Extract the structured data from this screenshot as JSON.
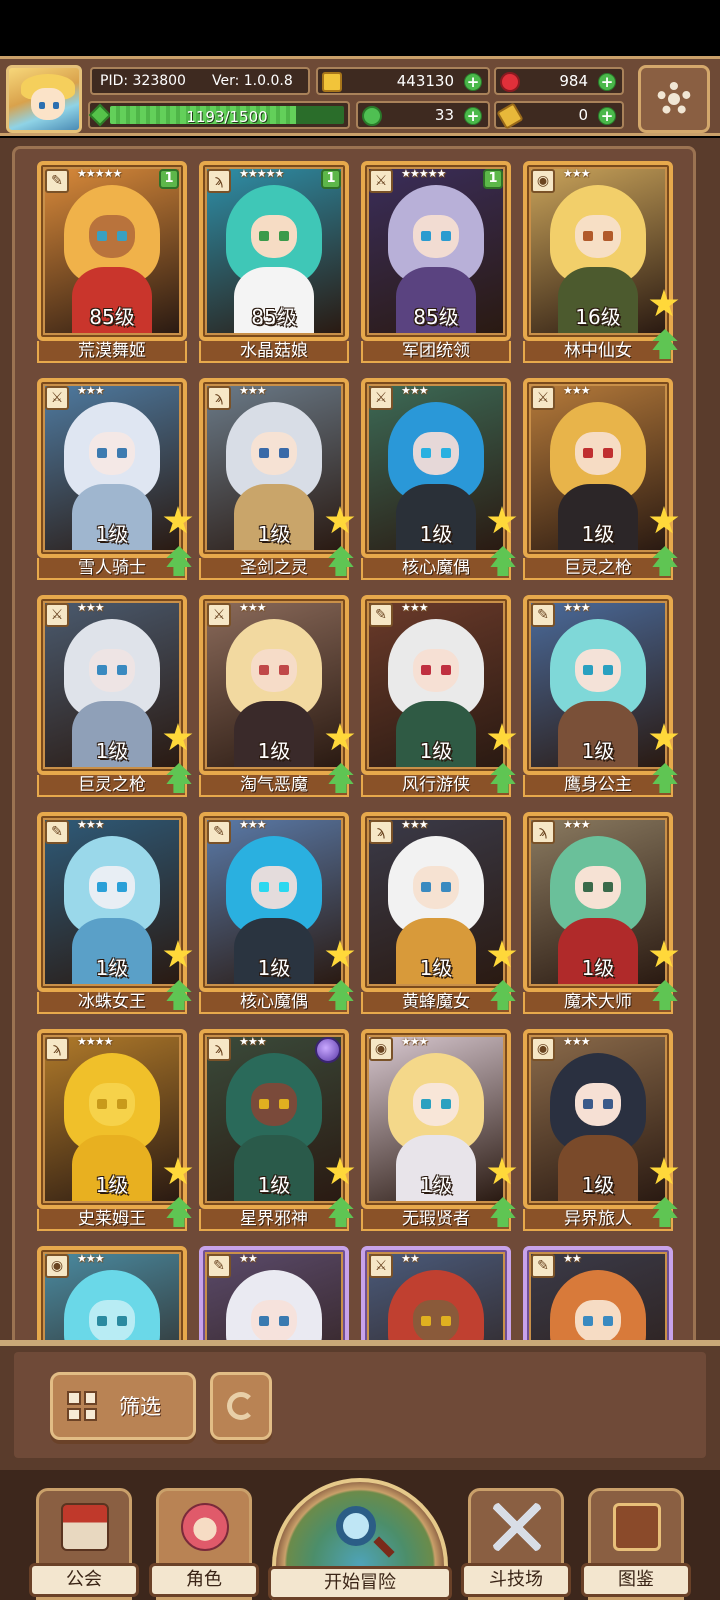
{
  "player": {
    "pid": "PID: 323800",
    "version": "Ver: 1.0.0.8",
    "xp_text": "1193/1500",
    "xp_fraction": 0.7953
  },
  "resources": {
    "gold": "443130",
    "gems": "984",
    "clover": "33",
    "keys": "0",
    "plus": "+"
  },
  "heroes": [
    {
      "name": "荒漠舞姬",
      "level": "85级",
      "stars": "★★★★★",
      "badge": "1",
      "class_icon": "feather-icon",
      "hair": "#f0b24a",
      "skin": "#b9733c",
      "body": "#c9352c",
      "bg": "#d98a3a",
      "eye": "#3aa0c0"
    },
    {
      "name": "水晶菇娘",
      "level": "85级",
      "stars": "★★★★★",
      "badge": "1",
      "class_icon": "wand-icon",
      "hair": "#3fc7b7",
      "skin": "#f6dcc4",
      "body": "#f4f4f4",
      "bg": "#2e8fa8",
      "eye": "#3a9a4a"
    },
    {
      "name": "军团统领",
      "level": "85级",
      "stars": "★★★★★",
      "badge": "1",
      "class_icon": "sword-icon",
      "hair": "#b8b0d8",
      "skin": "#f2dcd2",
      "body": "#5a4380",
      "bg": "#3a2d5a",
      "eye": "#2a9bd0"
    },
    {
      "name": "林中仙女",
      "level": "16级",
      "stars": "★★★",
      "badge": "",
      "class_icon": "shield-icon",
      "hair": "#f2cf6a",
      "skin": "#f7dfc5",
      "body": "#4c5a2e",
      "bg": "#c9a35a",
      "eye": "#b25a2a"
    },
    {
      "name": "雪人骑士",
      "level": "1级",
      "stars": "★★★",
      "badge": "",
      "class_icon": "sword-icon",
      "hair": "#dfe6f2",
      "skin": "#f4e8e6",
      "body": "#9fb6cf",
      "bg": "#4e7aa0",
      "eye": "#3d7bb0"
    },
    {
      "name": "圣剑之灵",
      "level": "1级",
      "stars": "★★★",
      "badge": "",
      "class_icon": "wand-icon",
      "hair": "#d8dde6",
      "skin": "#f6e2d4",
      "body": "#c9a56a",
      "bg": "#6a7a88",
      "eye": "#3a6aa8"
    },
    {
      "name": "核心魔偶",
      "level": "1级",
      "stars": "★★★",
      "badge": "",
      "class_icon": "sword-icon",
      "hair": "#2a98d8",
      "skin": "#e6d8d8",
      "body": "#2a3038",
      "bg": "#3c6a56",
      "eye": "#2ab0e0"
    },
    {
      "name": "巨灵之枪",
      "level": "1级",
      "stars": "★★★",
      "badge": "",
      "class_icon": "sword-icon",
      "hair": "#e8b44a",
      "skin": "#f6dcc4",
      "body": "#2c2628",
      "bg": "#b57a3a",
      "eye": "#c03030"
    },
    {
      "name": "巨灵之枪",
      "level": "1级",
      "stars": "★★★",
      "badge": "",
      "class_icon": "sword-icon",
      "hair": "#dfe3ea",
      "skin": "#eee4e4",
      "body": "#8fa0b8",
      "bg": "#4a5a6e",
      "eye": "#3a8ac0"
    },
    {
      "name": "淘气恶魔",
      "level": "1级",
      "stars": "★★★",
      "badge": "",
      "class_icon": "sword-icon",
      "hair": "#f2d9a0",
      "skin": "#f6dcc8",
      "body": "#3a2a2a",
      "bg": "#8a6a5a",
      "eye": "#c04848"
    },
    {
      "name": "风行游侠",
      "level": "1级",
      "stars": "★★★",
      "badge": "",
      "class_icon": "feather-icon",
      "hair": "#eaeaea",
      "skin": "#f6e0d4",
      "body": "#2f5a44",
      "bg": "#6a3a2a",
      "eye": "#c03040"
    },
    {
      "name": "鹰身公主",
      "level": "1级",
      "stars": "★★★",
      "badge": "",
      "class_icon": "feather-icon",
      "hair": "#7fd8d8",
      "skin": "#f4e2d8",
      "body": "#7a5038",
      "bg": "#4a6a9a",
      "eye": "#2aa0c0"
    },
    {
      "name": "冰蛛女王",
      "level": "1级",
      "stars": "★★★",
      "badge": "",
      "class_icon": "feather-icon",
      "hair": "#9ad8ea",
      "skin": "#e8eef4",
      "body": "#5aa0c8",
      "bg": "#2e5a78",
      "eye": "#2aa0d8"
    },
    {
      "name": "核心魔偶",
      "level": "1级",
      "stars": "★★★",
      "badge": "",
      "class_icon": "feather-icon",
      "hair": "#2ab0e0",
      "skin": "#e4dcdc",
      "body": "#2a3440",
      "bg": "#5a7aa8",
      "eye": "#2ad8f0"
    },
    {
      "name": "黄蜂魔女",
      "level": "1级",
      "stars": "★★★",
      "badge": "",
      "class_icon": "wand-icon",
      "hair": "#f2f2f2",
      "skin": "#f6e2d2",
      "body": "#d89a3a",
      "bg": "#3a3a48",
      "eye": "#3a8ac0"
    },
    {
      "name": "魔术大师",
      "level": "1级",
      "stars": "★★★",
      "badge": "",
      "class_icon": "wand-icon",
      "hair": "#6ac09a",
      "skin": "#f6e2d4",
      "body": "#b02a2a",
      "bg": "#8a7a60",
      "eye": "#3a6a4a"
    },
    {
      "name": "史莱姆王",
      "level": "1级",
      "stars": "★★★★",
      "badge": "",
      "class_icon": "wand-icon",
      "hair": "#f0c02a",
      "skin": "#f6d24a",
      "body": "#e8b020",
      "bg": "#b07a2a",
      "eye": "#c89a1a"
    },
    {
      "name": "星界邪神",
      "level": "1级",
      "stars": "★★★",
      "badge": "orb",
      "class_icon": "wand-icon",
      "hair": "#2a6a5a",
      "skin": "#7a4a3a",
      "body": "#2a5a4a",
      "bg": "#3a4a3a",
      "eye": "#e0b020"
    },
    {
      "name": "无瑕贤者",
      "level": "1级",
      "stars": "★★★",
      "badge": "",
      "class_icon": "shield-icon",
      "hair": "#f4d88a",
      "skin": "#f8e6d8",
      "body": "#e8e4ea",
      "bg": "#d8c8d0",
      "eye": "#2aa0c0"
    },
    {
      "name": "异界旅人",
      "level": "1级",
      "stars": "★★★",
      "badge": "",
      "class_icon": "shield-icon",
      "hair": "#2a3040",
      "skin": "#f6e0d4",
      "body": "#7a4a2a",
      "bg": "#8a6a4a",
      "eye": "#3a5a8a"
    },
    {
      "name": "",
      "level": "",
      "stars": "★★★",
      "badge": "",
      "class_icon": "shield-icon",
      "hair": "#6ad8e8",
      "skin": "#b8ecf4",
      "body": "#5ac0d8",
      "bg": "#4a8aa0",
      "eye": "#2a8aa0"
    },
    {
      "name": "",
      "level": "",
      "stars": "★★",
      "badge": "",
      "class_icon": "feather-icon",
      "hair": "#eaeaf2",
      "skin": "#f6e2dc",
      "body": "#a8a8c0",
      "bg": "#5a4a6a",
      "eye": "#3a7ab0",
      "purple": true
    },
    {
      "name": "",
      "level": "",
      "stars": "★★",
      "badge": "",
      "class_icon": "sword-icon",
      "hair": "#c04030",
      "skin": "#8a5a3a",
      "body": "#3a2a2a",
      "bg": "#4a5a7a",
      "eye": "#e0b020",
      "purple": true
    },
    {
      "name": "",
      "level": "",
      "stars": "★★",
      "badge": "",
      "class_icon": "feather-icon",
      "hair": "#d87a3a",
      "skin": "#f6dcc4",
      "body": "#7a4a2a",
      "bg": "#3a3a48",
      "eye": "#3a8ac0",
      "purple": true
    }
  ],
  "controls": {
    "filter_label": "筛选"
  },
  "nav": {
    "guild": "公会",
    "character": "角色",
    "adventure": "开始冒险",
    "arena": "斗技场",
    "codex": "图鉴"
  }
}
